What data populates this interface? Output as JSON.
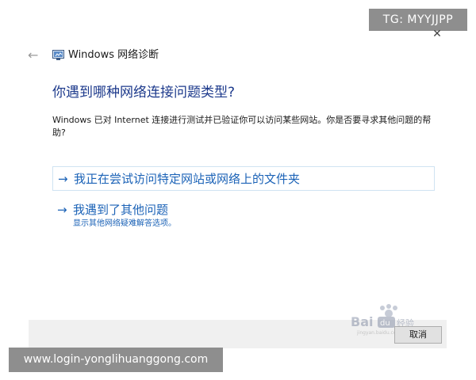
{
  "watermark_top": "TG: MYYJJPP",
  "window": {
    "close_glyph": "✕",
    "back_glyph": "←",
    "title": "Windows 网络诊断",
    "app_icon": "network-diagnostics-icon"
  },
  "content": {
    "question": "你遇到哪种网络连接问题类型?",
    "description": "Windows 已对 Internet 连接进行测试并已验证你可以访问某些网站。你是否要寻求其他问题的帮助?"
  },
  "options": [
    {
      "arrow": "→",
      "label": "我正在尝试访问特定网站或网络上的文件夹"
    },
    {
      "arrow": "→",
      "label": "我遇到了其他问题",
      "sublabel": "显示其他网络疑难解答选项。"
    }
  ],
  "footer": {
    "cancel_label": "取消"
  },
  "baidu_logo": {
    "text": "Bai du 经验",
    "url_text": "jingyan.baidu.com"
  },
  "watermark_bottom": "www.login-yonglihuanggong.com",
  "colors": {
    "accent": "#1c63b7",
    "question": "#1d3a8c",
    "footer_bg": "#f0f0f0",
    "watermark_bg": "#8e8e8e"
  }
}
